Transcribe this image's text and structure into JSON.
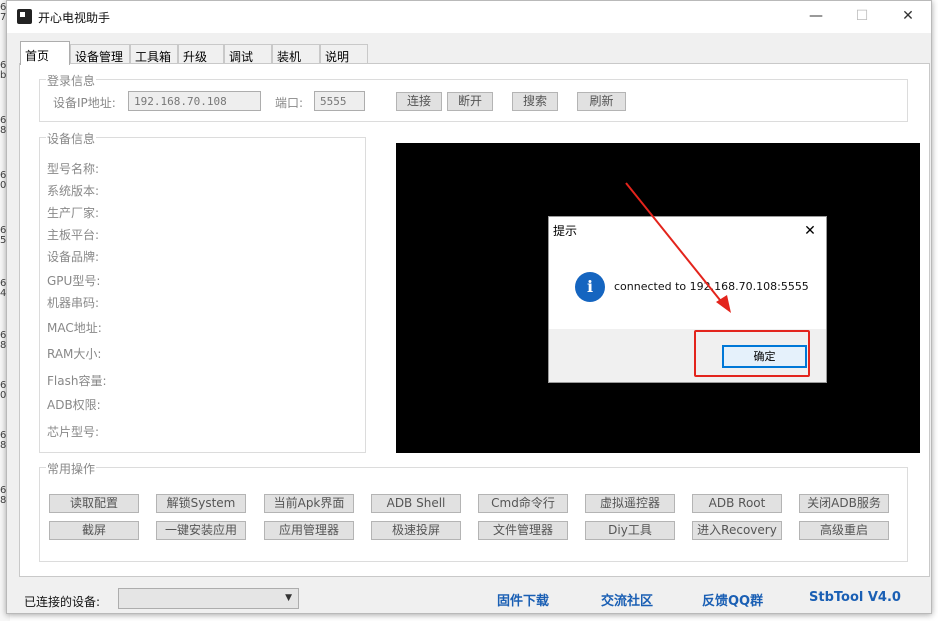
{
  "window": {
    "title": "开心电视助手"
  },
  "tabs": [
    "首页",
    "设备管理",
    "工具箱",
    "升级",
    "调试",
    "装机",
    "说明"
  ],
  "login": {
    "group_title": "登录信息",
    "ip_label": "设备IP地址:",
    "ip_value": "192.168.70.108",
    "port_label": "端口:",
    "port_value": "5555",
    "connect": "连接",
    "disconnect": "断开",
    "search": "搜索",
    "refresh": "刷新"
  },
  "device": {
    "group_title": "设备信息",
    "fields": [
      "型号名称:",
      "系统版本:",
      "生产厂家:",
      "主板平台:",
      "设备品牌:",
      "GPU型号:",
      "机器串码:",
      "MAC地址:",
      "RAM大小:",
      "Flash容量:",
      "ADB权限:",
      "芯片型号:"
    ]
  },
  "ops": {
    "group_title": "常用操作",
    "row1": [
      "读取配置",
      "解锁System",
      "当前Apk界面",
      "ADB Shell",
      "Cmd命令行",
      "虚拟遥控器",
      "ADB  Root",
      "关闭ADB服务"
    ],
    "row2": [
      "截屏",
      "一键安装应用",
      "应用管理器",
      "极速投屏",
      "文件管理器",
      "Diy工具",
      "进入Recovery",
      "高级重启"
    ]
  },
  "bottom": {
    "connected_label": "已连接的设备:",
    "connected_value": "",
    "firmware": "固件下载",
    "community": "交流社区",
    "feedback": "反馈QQ群",
    "version": "StbTool V4.0"
  },
  "dialog": {
    "title": "提示",
    "message": "connected to 192.168.70.108:5555",
    "ok": "确定"
  },
  "icons": [
    "app-icon",
    "minimize-icon",
    "maximize-icon",
    "close-icon",
    "info-icon",
    "chevron-down-icon"
  ],
  "colors": {
    "link": "#1a5fb4",
    "highlight": "#e3241c",
    "info_icon": "#1565c0"
  }
}
